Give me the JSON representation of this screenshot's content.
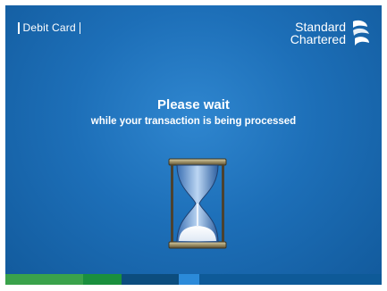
{
  "header": {
    "card_type_label": "Debit Card",
    "brand_line1": "Standard",
    "brand_line2": "Chartered"
  },
  "message": {
    "title": "Please wait",
    "subtitle": "while your transaction is being processed"
  },
  "icons": {
    "brand_logo": "standard-chartered-logo",
    "status": "hourglass-icon"
  },
  "colors": {
    "background": "#1d6fb8",
    "text": "#ffffff",
    "stripe": [
      "#3aa24b",
      "#1a8f3d",
      "#0c4d7e",
      "#2b8ad9",
      "#0e5a98"
    ]
  }
}
